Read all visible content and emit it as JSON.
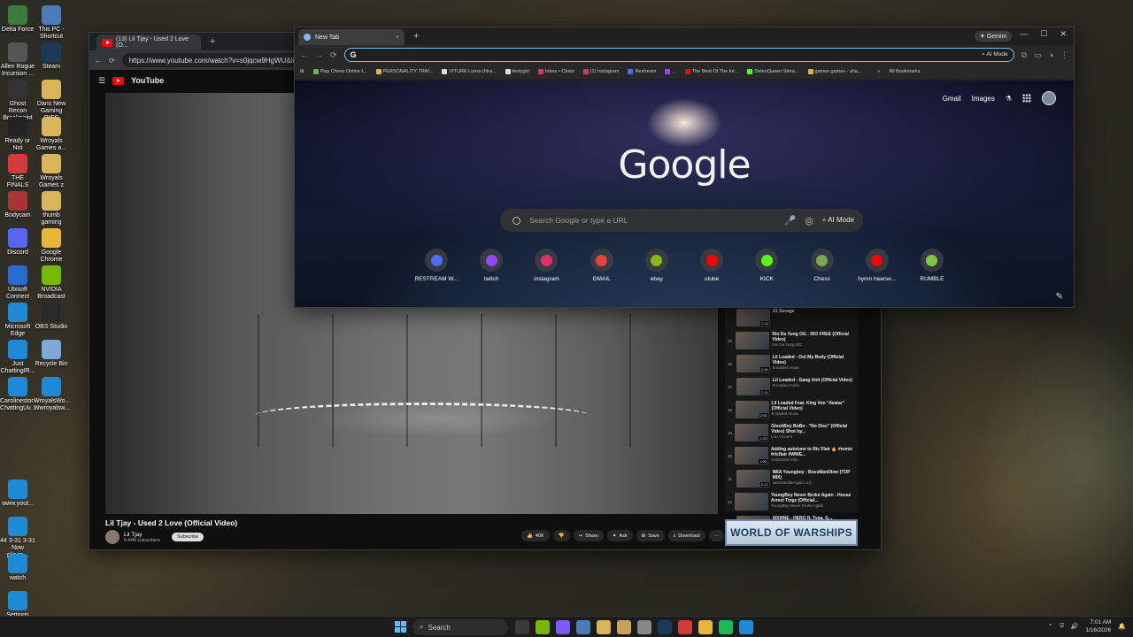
{
  "desktop": {
    "icons": [
      {
        "label": "Delta Force",
        "color": "#3b7b3b"
      },
      {
        "label": "This PC - Shortcut",
        "color": "#4a7ab8"
      },
      {
        "label": "Allen Rogue Incursion ...",
        "color": "#555"
      },
      {
        "label": "Steam",
        "color": "#1b3a5a"
      },
      {
        "label": "Ghost Recon Breakpoint",
        "color": "#333"
      },
      {
        "label": "Dans New Gaming PICS",
        "color": "#d9b45a"
      },
      {
        "label": "Ready or Not",
        "color": "#222"
      },
      {
        "label": "Wroyals Games a...",
        "color": "#d9b45a"
      },
      {
        "label": "THE FINALS",
        "color": "#d23b3b"
      },
      {
        "label": "Wroyals Games z",
        "color": "#d9b45a"
      },
      {
        "label": "Bodycam",
        "color": "#a33"
      },
      {
        "label": "thumb gaming",
        "color": "#d9b45a"
      },
      {
        "label": "Discord",
        "color": "#5865f2"
      },
      {
        "label": "Google Chrome",
        "color": "#e8b73a"
      },
      {
        "label": "Ubisoft Connect",
        "color": "#2a6bd1"
      },
      {
        "label": "NVIDIA Broadcast",
        "color": "#76b900"
      },
      {
        "label": "Microsoft Edge",
        "color": "#1e8ad6"
      },
      {
        "label": "OBS Studio",
        "color": "#2a2a2a"
      },
      {
        "label": "Just ChattingIR...",
        "color": "#1e8ad6"
      },
      {
        "label": "Recycle Bin",
        "color": "#7fa9d6"
      },
      {
        "label": "Carolinestor... ChattingUv...",
        "color": "#1e8ad6"
      },
      {
        "label": "WroyalsWo... Wwroyalsw...",
        "color": "#1e8ad6"
      },
      {
        "label": "www.yout...",
        "color": "#1e8ad6"
      },
      {
        "label": "44 3-31 3-31 Now playin...",
        "color": "#1e8ad6"
      },
      {
        "label": "watch",
        "color": "#1e8ad6"
      },
      {
        "label": "Settings",
        "color": "#1e8ad6"
      }
    ]
  },
  "youtube_window": {
    "tab_title": "(13) Lil Tjay - Used 2 Love (O...",
    "url": "https://www.youtube.com/watch?v=s0jqcw9HgWU&list=...",
    "site_name": "YouTube",
    "video_title": "Lil Tjay - Used 2 Love (Official Video)",
    "channel_name": "Lil Tjay",
    "subscribers": "6.44M subscribers",
    "subscribe_label": "Subscribe",
    "actions": {
      "likes": "40K",
      "share": "Share",
      "ask": "Ask",
      "save": "Save",
      "download": "Download"
    },
    "playlist": [
      {
        "num": "",
        "title": "21 Savage",
        "channel": "",
        "duration": "2:44"
      },
      {
        "num": "15",
        "title": "Rio Da Yung OG - RIO FREE (Official Video)",
        "channel": "Rio Da Yung OG",
        "duration": ""
      },
      {
        "num": "16",
        "title": "Lil Loaded - Out My Body (Official Video)",
        "channel": "B loaded music",
        "duration": "2:40"
      },
      {
        "num": "17",
        "title": "Lil Loaded - Gang Unit (Official Video)",
        "channel": "B loaded music",
        "duration": "2:31"
      },
      {
        "num": "18",
        "title": "Lil Loaded Feat. King Von \"Avatar\" (Official Video)",
        "channel": "B loaded music",
        "duration": "2:55"
      },
      {
        "num": "19",
        "title": "GlockBoy BoBo - \"No Diss\" (Official Video) Shot by...",
        "channel": "Lou Vincent",
        "duration": "2:23"
      },
      {
        "num": "20",
        "title": "Adding autotune to Ric Flair 🔥 #remix #ricflair #WWE...",
        "channel": "Autotuned Vids",
        "duration": "1:00"
      },
      {
        "num": "21",
        "title": "NBA Youngboy - BossManDlow (TOP MIX)",
        "channel": "NeverBrokeAgain LLC",
        "duration": "2:22"
      },
      {
        "num": "22",
        "title": "YoungBoy Never Broke Again - House Arrest Tingz (Official...",
        "channel": "YoungBoy Never Broke Again",
        "duration": ""
      },
      {
        "num": "",
        "title": "6IX9INE - HERO ft. Tyga, G...",
        "channel": "",
        "duration": ""
      }
    ],
    "ad_text": "WORLD OF WARSHIPS"
  },
  "chrome_window": {
    "tab_title": "New Tab",
    "gemini_label": "Gemini",
    "address_ai_mode": "AI Mode",
    "bookmarks": [
      {
        "label": "Play Chess Online f...",
        "color": "#7fa650"
      },
      {
        "label": "PERSONALITY TRAI...",
        "color": "#d9b45a"
      },
      {
        "label": "VITURE Luma Ultra...",
        "color": "#ddd"
      },
      {
        "label": "fentygirl",
        "color": "#ddd"
      },
      {
        "label": "Inbox • Chats",
        "color": "#e1306c"
      },
      {
        "label": "(1) Instagram",
        "color": "#e1306c"
      },
      {
        "label": "Restream",
        "color": "#4c6ef5"
      },
      {
        "label": "...",
        "color": "#9146ff"
      },
      {
        "label": "The Best Of The Int...",
        "color": "#ff0000"
      },
      {
        "label": "DelenQueen Strea...",
        "color": "#53fc18"
      },
      {
        "label": "games games - sha...",
        "color": "#d9b45a"
      }
    ],
    "all_bookmarks": "All Bookmarks",
    "top_links": {
      "gmail": "Gmail",
      "images": "Images"
    },
    "logo_text": "Google",
    "search_placeholder": "Search Google or type a URL",
    "search_ai_mode": "AI Mode",
    "shortcuts": [
      {
        "label": "RESTREAM W...",
        "color": "#4c6ef5"
      },
      {
        "label": "twitch",
        "color": "#9146ff"
      },
      {
        "label": "instagram",
        "color": "#e1306c"
      },
      {
        "label": "GMAIL",
        "color": "#ea4335"
      },
      {
        "label": "ebay",
        "color": "#86b817"
      },
      {
        "label": "utube",
        "color": "#ff0000"
      },
      {
        "label": "KICK",
        "color": "#53fc18"
      },
      {
        "label": "Chess",
        "color": "#7fa650"
      },
      {
        "label": "hymn hearse...",
        "color": "#ff0000"
      },
      {
        "label": "RUMBLE",
        "color": "#85c742"
      }
    ]
  },
  "taskbar": {
    "search_label": "Search",
    "apps": [
      "#3a3a3a",
      "#76b900",
      "#7a5af8",
      "#4a7ab8",
      "#d9b45a",
      "#c7a35a",
      "#888",
      "#1b3a5a",
      "#d23b3b",
      "#e8b73a",
      "#1db954",
      "#1e8ad6"
    ],
    "time": "7:01 AM",
    "date": "1/16/2026"
  }
}
